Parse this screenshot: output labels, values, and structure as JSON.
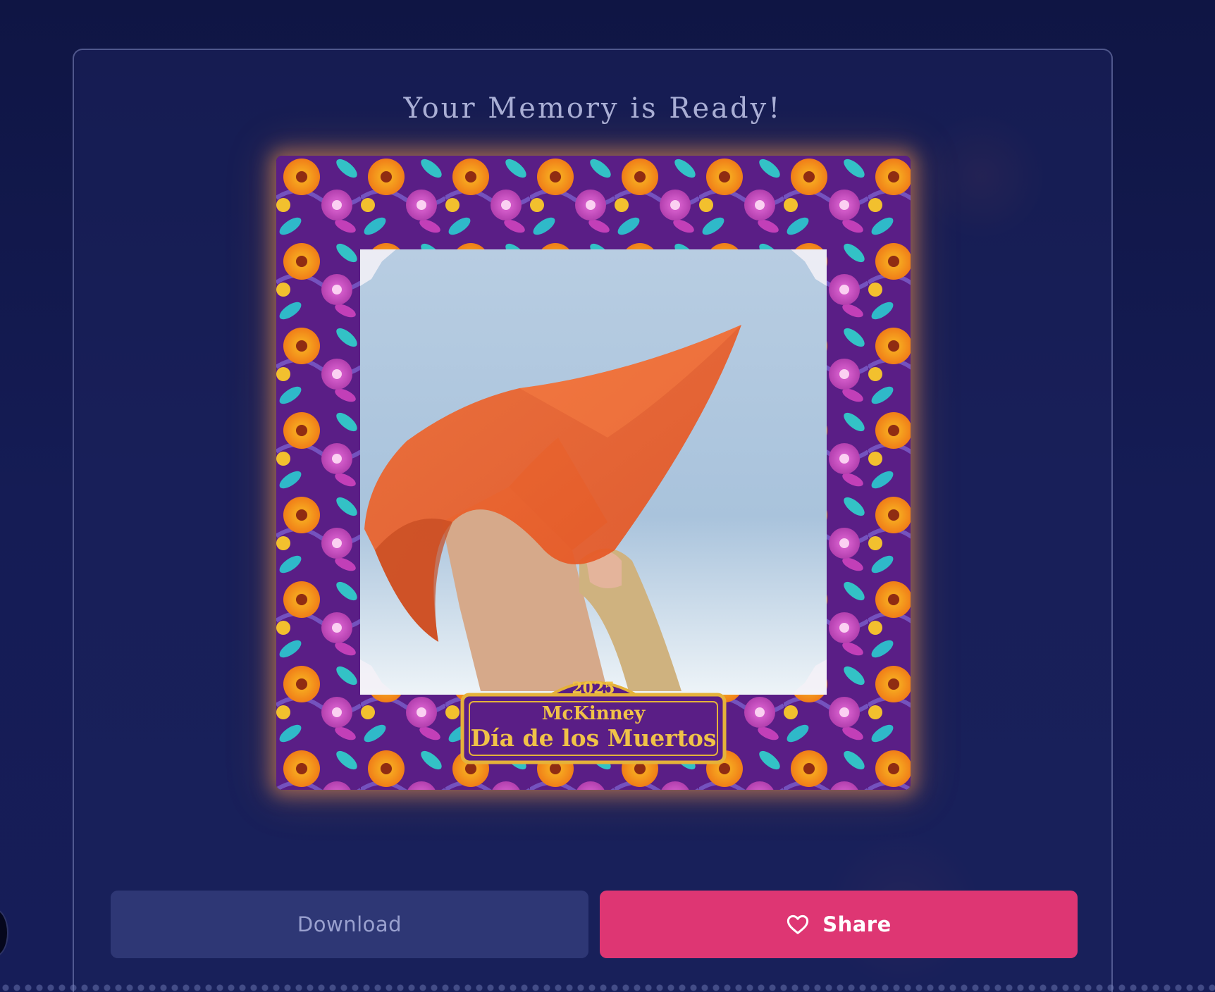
{
  "card": {
    "title": "Your Memory is Ready!"
  },
  "photo": {
    "badge_year": "2025",
    "badge_line1": "McKinney",
    "badge_line2": "Día de los Muertos"
  },
  "actions": {
    "download_label": "Download",
    "share_label": "Share"
  },
  "colors": {
    "background": "#111747",
    "card_border": "#6d76ad",
    "download_button": "#2e3775",
    "share_button": "#de3673",
    "frame_purple": "#5a1e86",
    "badge_gold": "#e5b23a"
  },
  "icons": {
    "share": "heart-icon"
  }
}
